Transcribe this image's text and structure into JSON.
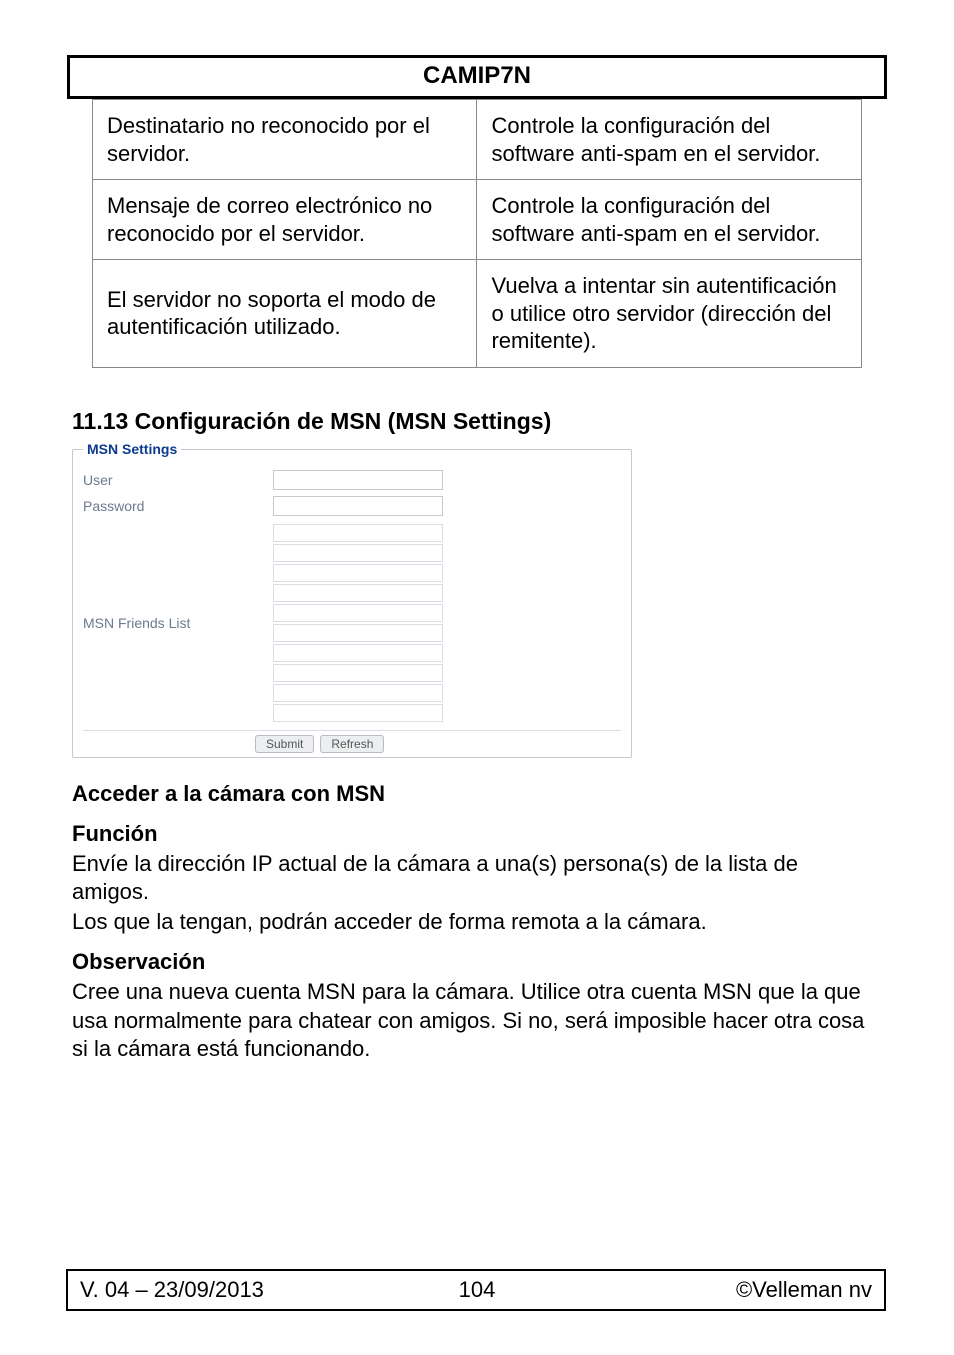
{
  "header": {
    "title": "CAMIP7N"
  },
  "table": {
    "rows": [
      {
        "left": "Destinatario no reconocido por el servidor.",
        "right": "Controle la configuración del software anti-spam en el servidor."
      },
      {
        "left": "Mensaje de correo electrónico no reconocido por el servidor.",
        "right": "Controle la configuración del software anti-spam en el servidor."
      },
      {
        "left": "El servidor no soporta el modo de autentificación utilizado.",
        "right": "Vuelva a intentar sin autentificación o utilice otro servidor (dirección del remitente)."
      }
    ]
  },
  "section": {
    "title": "11.13 Configuración de MSN (MSN Settings)"
  },
  "msn": {
    "legend": "MSN Settings",
    "user_label": "User",
    "password_label": "Password",
    "friends_label": "MSN Friends List",
    "submit_label": "Submit",
    "refresh_label": "Refresh",
    "user_value": "",
    "password_value": "",
    "friends": [
      "",
      "",
      "",
      "",
      "",
      "",
      "",
      "",
      "",
      ""
    ]
  },
  "text": {
    "h_access": "Acceder a la cámara con MSN",
    "h_function": "Función",
    "p_function_1": "Envíe la dirección IP actual de la cámara a una(s) persona(s) de la lista de amigos.",
    "p_function_2": "Los que la tengan, podrán acceder de forma remota a la cámara.",
    "h_obs": "Observación",
    "p_obs": "Cree una nueva cuenta MSN para la cámara. Utilice otra cuenta MSN que la que usa normalmente para chatear con amigos. Si no, será imposible hacer otra cosa si la cámara está funcionando."
  },
  "footer": {
    "left": "V. 04 – 23/09/2013",
    "center": "104",
    "right": "©Velleman nv"
  }
}
